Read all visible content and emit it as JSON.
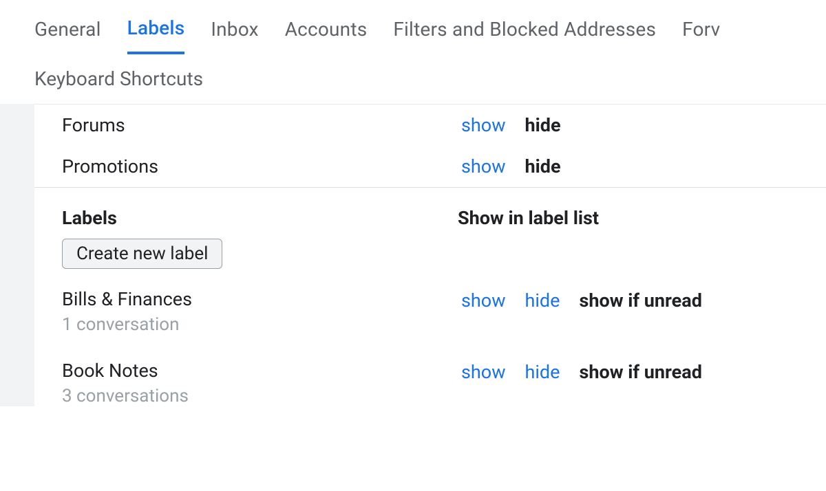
{
  "tabs": {
    "row1": [
      {
        "id": "general",
        "label": "General",
        "active": false
      },
      {
        "id": "labels",
        "label": "Labels",
        "active": true
      },
      {
        "id": "inbox",
        "label": "Inbox",
        "active": false
      },
      {
        "id": "accounts",
        "label": "Accounts",
        "active": false
      },
      {
        "id": "filters",
        "label": "Filters and Blocked Addresses",
        "active": false
      },
      {
        "id": "forwarding",
        "label": "Forv",
        "active": false
      }
    ],
    "row2": [
      {
        "id": "shortcuts",
        "label": "Keyboard Shortcuts"
      }
    ]
  },
  "categories": [
    {
      "name": "Forums",
      "show": "show",
      "hide": "hide"
    },
    {
      "name": "Promotions",
      "show": "show",
      "hide": "hide"
    }
  ],
  "labels_section": {
    "title": "Labels",
    "column_title": "Show in label list",
    "create_button": "Create new label",
    "items": [
      {
        "name": "Bills & Finances",
        "conversations": "1 conversation",
        "show": "show",
        "hide": "hide",
        "unread": "show if unread"
      },
      {
        "name": "Book Notes",
        "conversations": "3 conversations",
        "show": "show",
        "hide": "hide",
        "unread": "show if unread"
      }
    ]
  }
}
